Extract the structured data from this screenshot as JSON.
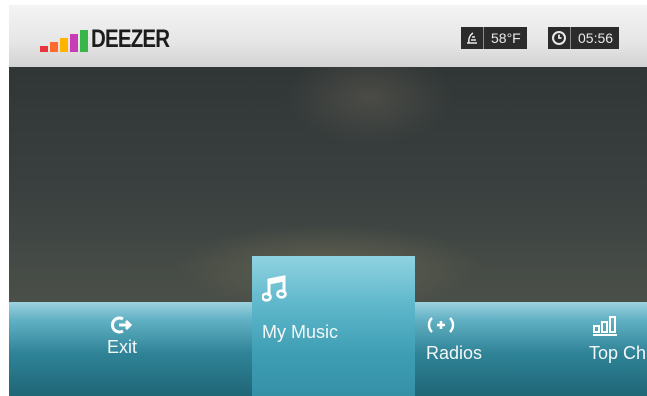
{
  "app": {
    "logo_text": "DEEZER"
  },
  "status": {
    "temperature": "58°F",
    "time": "05:56"
  },
  "menu": {
    "items": [
      {
        "label": "Exit",
        "icon": "exit-icon"
      },
      {
        "label": "My Music",
        "icon": "music-note-icon",
        "selected": true
      },
      {
        "label": "Radios",
        "icon": "radio-waves-icon"
      },
      {
        "label": "Top Ch",
        "icon": "chart-bars-icon"
      }
    ]
  },
  "colors": {
    "menu_bar": "#3c95a9",
    "selected_item": "#5fb7cb",
    "logo_eq": "#ff3a3a",
    "status_bg": "#2b2b2b"
  }
}
